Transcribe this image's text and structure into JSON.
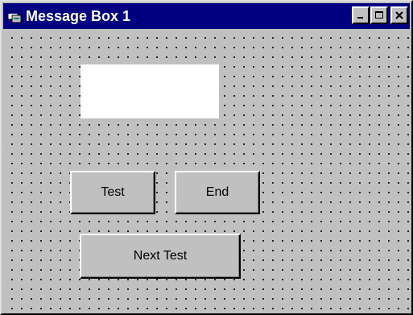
{
  "window": {
    "title": "Message Box 1",
    "icon": "form-app-icon",
    "controls": {
      "minimize_icon": "minimize-icon",
      "maximize_icon": "maximize-icon",
      "close_icon": "close-icon"
    }
  },
  "form": {
    "textbox_value": "",
    "buttons": {
      "test_label": "Test",
      "end_label": "End",
      "next_test_label": "Next Test"
    }
  },
  "colors": {
    "titlebar": "#000080",
    "face": "#c0c0c0",
    "textbox": "#ffffff"
  }
}
